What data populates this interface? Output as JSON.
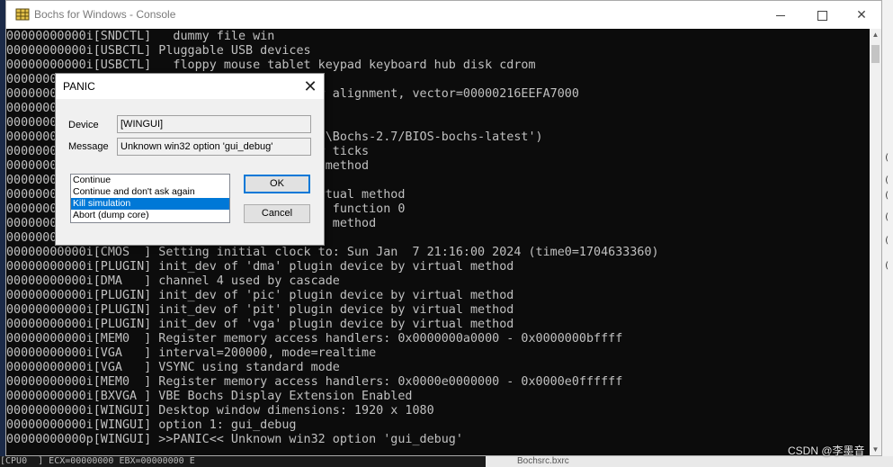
{
  "window": {
    "title": "Bochs for Windows - Console",
    "min_label": "",
    "max_label": "",
    "close_label": "✕"
  },
  "console_lines": [
    "00000000000i[SNDCTL]   dummy file win",
    "00000000000i[USBCTL] Pluggable USB devices",
    "00000000000i[USBCTL]   floppy mouse tablet keypad keyboard hub disk cdrom",
    "00000000000i[",
    "00000000000i[           00216EEFA6040. after alignment, vector=00000216EEFA7000",
    "00000000000i[",
    "00000000000i[           0000, blocks=256",
    "00000000000i[           2 ('C:\\Program Files\\Bochs-2.7/BIOS-bochs-latest')",
    "00000000000i[           very 100 iodev timer ticks",
    "00000000000i[           n device by virtual method",
    "00000000000i[           evice 0, function 0",
    "00000000000i[           plugin device by virtual method",
    "00000000000i[           present at device 1, function 0",
    "00000000000i[           in device by virtual method",
    "00000000000i[           itial clock",
    "00000000000i[CMOS  ] Setting initial clock to: Sun Jan  7 21:16:00 2024 (time0=1704633360)",
    "00000000000i[PLUGIN] init_dev of 'dma' plugin device by virtual method",
    "00000000000i[DMA   ] channel 4 used by cascade",
    "00000000000i[PLUGIN] init_dev of 'pic' plugin device by virtual method",
    "00000000000i[PLUGIN] init_dev of 'pit' plugin device by virtual method",
    "00000000000i[PLUGIN] init_dev of 'vga' plugin device by virtual method",
    "00000000000i[MEM0  ] Register memory access handlers: 0x0000000a0000 - 0x0000000bffff",
    "00000000000i[VGA   ] interval=200000, mode=realtime",
    "00000000000i[VGA   ] VSYNC using standard mode",
    "00000000000i[MEM0  ] Register memory access handlers: 0x0000e0000000 - 0x0000e0ffffff",
    "00000000000i[BXVGA ] VBE Bochs Display Extension Enabled",
    "00000000000i[WINGUI] Desktop window dimensions: 1920 x 1080",
    "00000000000i[WINGUI] option 1: gui_debug",
    "00000000000p[WINGUI] >>PANIC<< Unknown win32 option 'gui_debug'"
  ],
  "dialog": {
    "title": "PANIC",
    "close_label": "✕",
    "device_label": "Device",
    "device_value": "[WINGUI]",
    "message_label": "Message",
    "message_value": "Unknown win32 option 'gui_debug'",
    "options": [
      "Continue",
      "Continue and don't ask again",
      "Kill simulation",
      "Abort (dump core)"
    ],
    "selected_index": 2,
    "ok_label": "OK",
    "cancel_label": "Cancel"
  },
  "background": {
    "bottom_left_text": "[CPU0  ] ECX=00000000 EBX=00000000 E",
    "bottom_right_text": "Bochsrc.bxrc"
  },
  "watermark": "CSDN @李墨音"
}
